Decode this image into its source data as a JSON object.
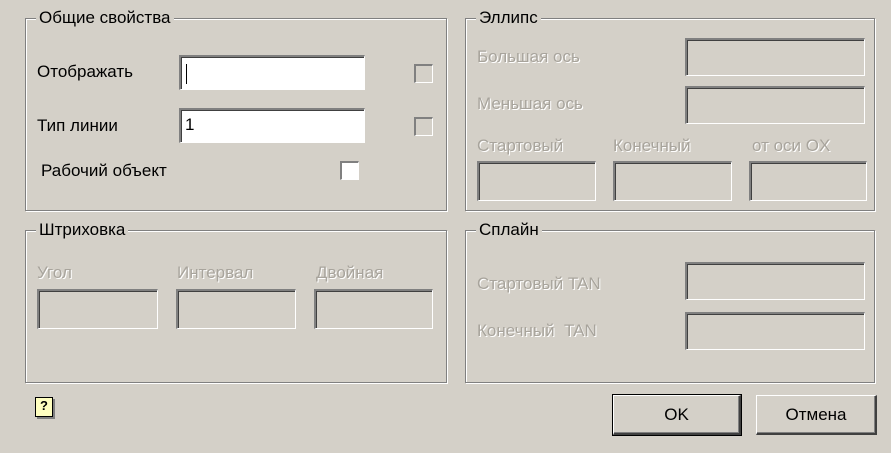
{
  "general": {
    "legend": "Общие свойства",
    "display_label": "Отображать",
    "display_value": "",
    "linetype_label": "Тип линии",
    "linetype_value": "1",
    "workobj_label": "Рабочий объект"
  },
  "ellipse": {
    "legend": "Эллипс",
    "major_label": "Большая ось",
    "minor_label": "Меньшая ось",
    "start_label": "Стартовый",
    "end_label": "Конечный",
    "axis_label": "от оси OX"
  },
  "hatch": {
    "legend": "Штриховка",
    "angle_label": "Угол",
    "interval_label": "Интервал",
    "double_label": "Двойная"
  },
  "spline": {
    "legend": "Сплайн",
    "start_tan_label": "Стартовый TAN",
    "end_tan_label": "Конечный  TAN"
  },
  "buttons": {
    "ok": "OK",
    "cancel": "Отмена",
    "help_icon": "?"
  },
  "colors": {
    "face": "#d4d0c8",
    "disabled_text": "#a8a49c"
  }
}
